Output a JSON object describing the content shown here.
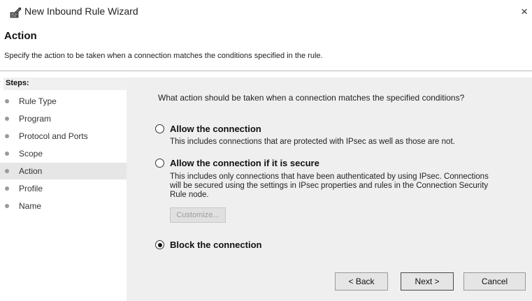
{
  "window": {
    "title": "New Inbound Rule Wizard",
    "close_glyph": "×"
  },
  "header": {
    "title": "Action",
    "description": "Specify the action to be taken when a connection matches the conditions specified in the rule."
  },
  "sidebar": {
    "title": "Steps:",
    "items": [
      {
        "label": "Rule Type"
      },
      {
        "label": "Program"
      },
      {
        "label": "Protocol and Ports"
      },
      {
        "label": "Scope"
      },
      {
        "label": "Action",
        "active": true
      },
      {
        "label": "Profile"
      },
      {
        "label": "Name"
      }
    ]
  },
  "main": {
    "question": "What action should be taken when a connection matches the specified conditions?",
    "options": [
      {
        "label": "Allow the connection",
        "description": "This includes connections that are protected with IPsec as well as those are not.",
        "selected": false
      },
      {
        "label": "Allow the connection if it is secure",
        "description_lines": [
          "This includes only connections that have been authenticated by using IPsec.  Connections",
          "will be secured using the settings in IPsec properties and rules in the Connection Security",
          "Rule node."
        ],
        "selected": false
      },
      {
        "label": "Block the connection",
        "selected": true
      }
    ],
    "customize_label": "Customize..."
  },
  "footer": {
    "back_label": "< Back",
    "next_label": "Next >",
    "cancel_label": "Cancel"
  },
  "icons": {
    "app": "firewall-wizard-icon",
    "close": "close-icon"
  }
}
